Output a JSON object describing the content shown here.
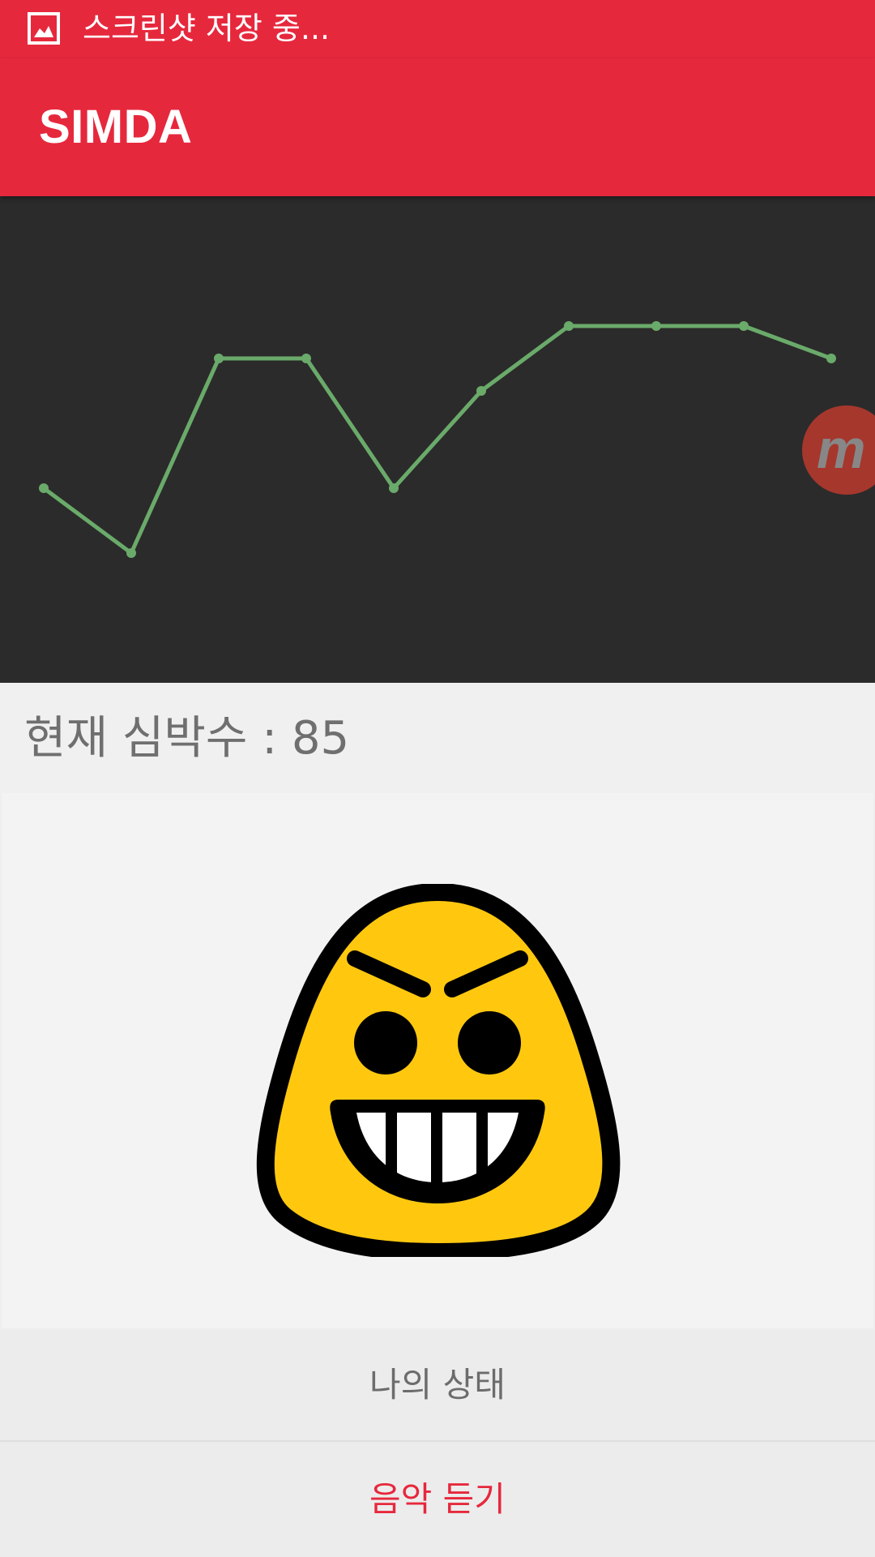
{
  "status_bar": {
    "icon": "image-icon",
    "text": "스크린샷 저장 중..."
  },
  "app_bar": {
    "title": "SIMDA"
  },
  "chart_data": {
    "type": "line",
    "title": "",
    "xlabel": "",
    "ylabel": "",
    "x": [
      1,
      2,
      3,
      4,
      5,
      6,
      7,
      8,
      9,
      10
    ],
    "values": [
      80,
      76,
      88,
      88,
      80,
      86,
      90,
      90,
      90,
      88
    ],
    "ylim": [
      68,
      98
    ],
    "grid": false,
    "colors": {
      "background": "#2b2b2b",
      "line": "#6aaa6a"
    }
  },
  "overlay_button": {
    "icon": "m-icon",
    "glyph": "m"
  },
  "heart_rate": {
    "text": "현재 심박수 : 85"
  },
  "mood": {
    "icon": "angry-grin-face-icon",
    "colors": {
      "face": "#ffc80f",
      "outline": "#000000",
      "teeth": "#ffffff"
    }
  },
  "buttons": {
    "my_status": "나의 상태",
    "listen_music": "음악 듣기"
  },
  "colors": {
    "accent": "#e6283d"
  }
}
